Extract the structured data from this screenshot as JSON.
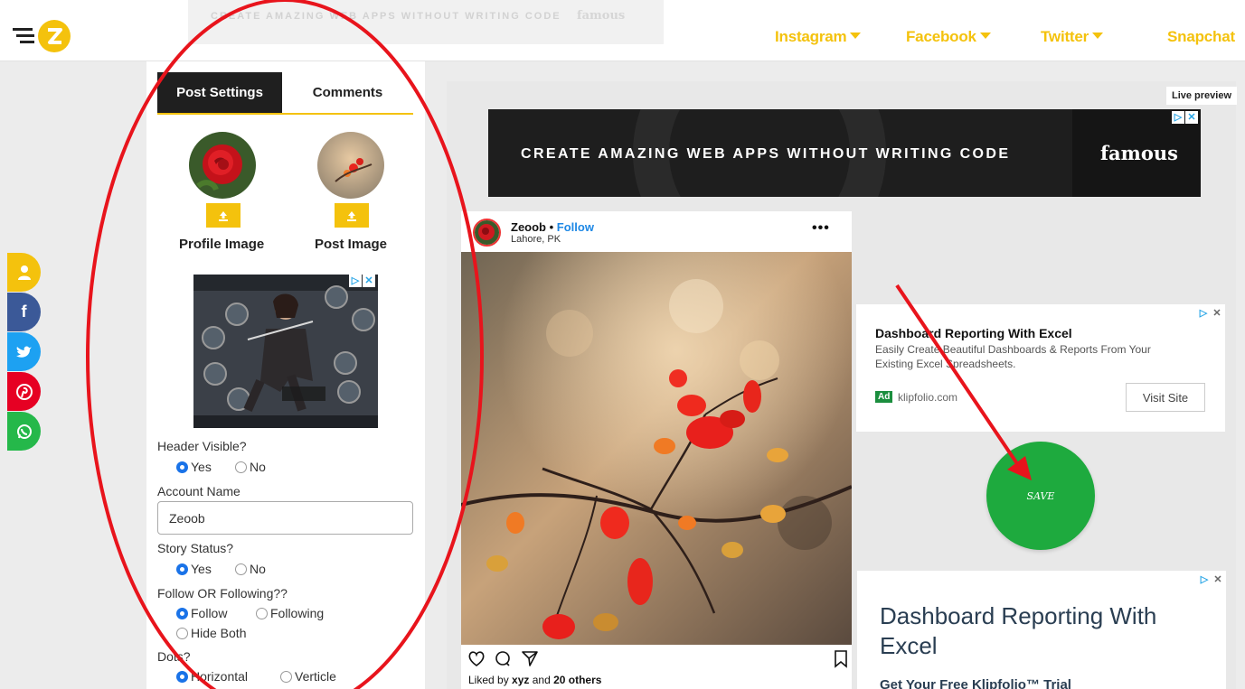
{
  "top_banner": {
    "text": "CREATE AMAZING WEB APPS WITHOUT WRITING CODE",
    "brand": "famous"
  },
  "nav": {
    "items": [
      {
        "label": "Instagram"
      },
      {
        "label": "Facebook"
      },
      {
        "label": "Twitter"
      },
      {
        "label": "Snapchat"
      }
    ]
  },
  "social": [
    "user-icon",
    "facebook-icon",
    "twitter-icon",
    "pinterest-icon",
    "whatsapp-icon"
  ],
  "panel": {
    "tabs": {
      "post_settings": "Post Settings",
      "comments": "Comments"
    },
    "profile_image_label": "Profile Image",
    "post_image_label": "Post Image",
    "header_visible": {
      "label": "Header Visible?",
      "yes": "Yes",
      "no": "No",
      "selected": "Yes"
    },
    "account_name": {
      "label": "Account Name",
      "value": "Zeoob"
    },
    "story_status": {
      "label": "Story Status?",
      "yes": "Yes",
      "no": "No",
      "selected": "Yes"
    },
    "follow": {
      "label": "Follow OR Following??",
      "follow": "Follow",
      "following": "Following",
      "hide": "Hide Both",
      "selected": "Follow"
    },
    "dots": {
      "label": "Dots?",
      "horizontal": "Horizontal",
      "verticle": "Verticle",
      "selected": "Horizontal"
    }
  },
  "preview": {
    "live_label": "Live preview",
    "banner": {
      "text": "CREATE AMAZING WEB APPS WITHOUT WRITING CODE",
      "brand": "famous"
    },
    "post": {
      "username": "Zeoob",
      "sep": " • ",
      "follow": "Follow",
      "location": "Lahore, PK",
      "more": "•••",
      "likes_prefix": "Liked by ",
      "likes_user": "xyz",
      "likes_mid": " and ",
      "likes_count": "20 others"
    }
  },
  "ads": {
    "card1": {
      "title": "Dashboard Reporting With Excel",
      "desc": "Easily Create Beautiful Dashboards & Reports From Your Existing Excel Spreadsheets.",
      "badge": "Ad",
      "domain": "klipfolio.com",
      "cta": "Visit Site"
    },
    "save": "SAVE",
    "card2": {
      "title": "Dashboard Reporting With Excel",
      "sub": "Get Your Free Klipfolio™ Trial"
    }
  },
  "colors": {
    "brand_yellow": "#f4c20d",
    "save_green": "#1eaa3e",
    "annotation_red": "#e8141c",
    "link_blue": "#1e88e5"
  }
}
